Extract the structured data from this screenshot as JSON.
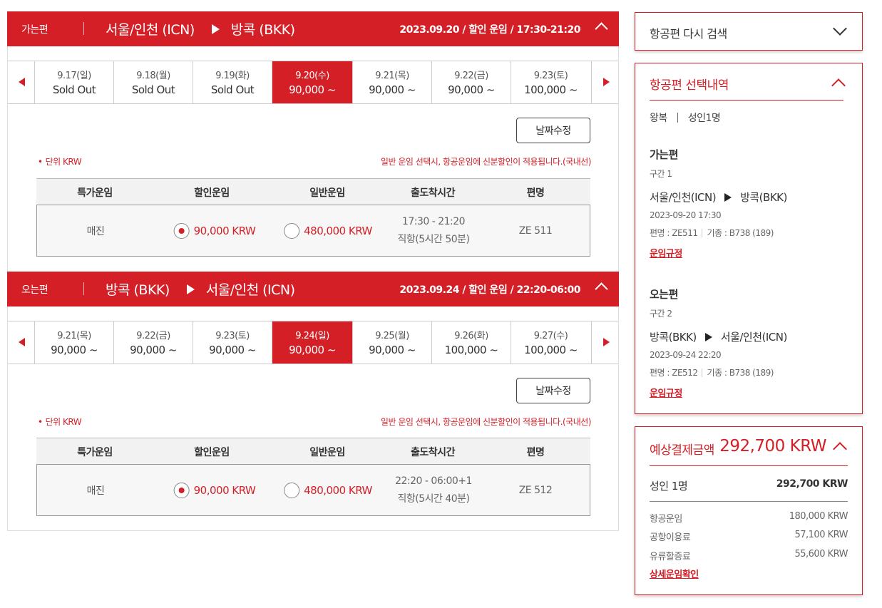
{
  "outbound": {
    "tag": "가는편",
    "from": "서울/인천 (ICN)",
    "to": "방콕 (BKK)",
    "summary": "2023.09.20 / 할인 운임 / 17:30-21:20",
    "days": [
      {
        "date": "9.17(일)",
        "price": "Sold Out"
      },
      {
        "date": "9.18(월)",
        "price": "Sold Out"
      },
      {
        "date": "9.19(화)",
        "price": "Sold Out"
      },
      {
        "date": "9.20(수)",
        "price": "90,000 ~",
        "selected": true
      },
      {
        "date": "9.21(목)",
        "price": "90,000 ~"
      },
      {
        "date": "9.22(금)",
        "price": "90,000 ~"
      },
      {
        "date": "9.23(토)",
        "price": "100,000 ~"
      }
    ],
    "edit_date_label": "날짜수정",
    "unit": "단위 KRW",
    "notice": "일반 운임 선택시, 항공운임에 신분할인이 적용됩니다.(국내선)",
    "columns": [
      "특가운임",
      "할인운임",
      "일반운임",
      "출도착시간",
      "편명"
    ],
    "special": "매진",
    "discount": "90,000 KRW",
    "normal": "480,000 KRW",
    "time": "17:30 - 21:20",
    "duration": "직항(5시간 50분)",
    "flight": "ZE 511"
  },
  "inbound": {
    "tag": "오는편",
    "from": "방콕 (BKK)",
    "to": "서울/인천 (ICN)",
    "summary": "2023.09.24 / 할인 운임 / 22:20-06:00",
    "days": [
      {
        "date": "9.21(목)",
        "price": "90,000 ~"
      },
      {
        "date": "9.22(금)",
        "price": "90,000 ~"
      },
      {
        "date": "9.23(토)",
        "price": "90,000 ~"
      },
      {
        "date": "9.24(일)",
        "price": "90,000 ~",
        "selected": true
      },
      {
        "date": "9.25(월)",
        "price": "90,000 ~"
      },
      {
        "date": "9.26(화)",
        "price": "100,000 ~"
      },
      {
        "date": "9.27(수)",
        "price": "100,000 ~"
      }
    ],
    "edit_date_label": "날짜수정",
    "unit": "단위 KRW",
    "notice": "일반 운임 선택시, 항공운임에 신분할인이 적용됩니다.(국내선)",
    "columns": [
      "특가운임",
      "할인운임",
      "일반운임",
      "출도착시간",
      "편명"
    ],
    "special": "매진",
    "discount": "90,000 KRW",
    "normal": "480,000 KRW",
    "time": "22:20 - 06:00+1",
    "duration": "직항(5시간 40분)",
    "flight": "ZE 512"
  },
  "sidebar": {
    "research_label": "항공편 다시 검색",
    "selection_title": "항공편 선택내역",
    "trip_type": "왕복",
    "passengers": "성인1명",
    "legs": [
      {
        "title": "가는편",
        "section": "구간 1",
        "from": "서울/인천(ICN)",
        "to": "방콕(BKK)",
        "datetime": "2023-09-20 17:30",
        "flight": "편명 : ZE511",
        "aircraft": "기종 : B738 (189)",
        "rules_link": "운임규정"
      },
      {
        "title": "오는편",
        "section": "구간 2",
        "from": "방콕(BKK)",
        "to": "서울/인천(ICN)",
        "datetime": "2023-09-24 22:20",
        "flight": "편명 : ZE512",
        "aircraft": "기종 : B738 (189)",
        "rules_link": "운임규정"
      }
    ],
    "payment": {
      "title": "예상결제금액",
      "total": "292,700 KRW",
      "adult_label": "성인 1명",
      "adult_value": "292,700 KRW",
      "items": [
        {
          "label": "항공운임",
          "value": "180,000 KRW"
        },
        {
          "label": "공항이용료",
          "value": "57,100 KRW"
        },
        {
          "label": "유류할증료",
          "value": "55,600 KRW"
        }
      ],
      "detail_link": "상세운임확인"
    }
  },
  "colors": {
    "accent": "#d41f26"
  }
}
